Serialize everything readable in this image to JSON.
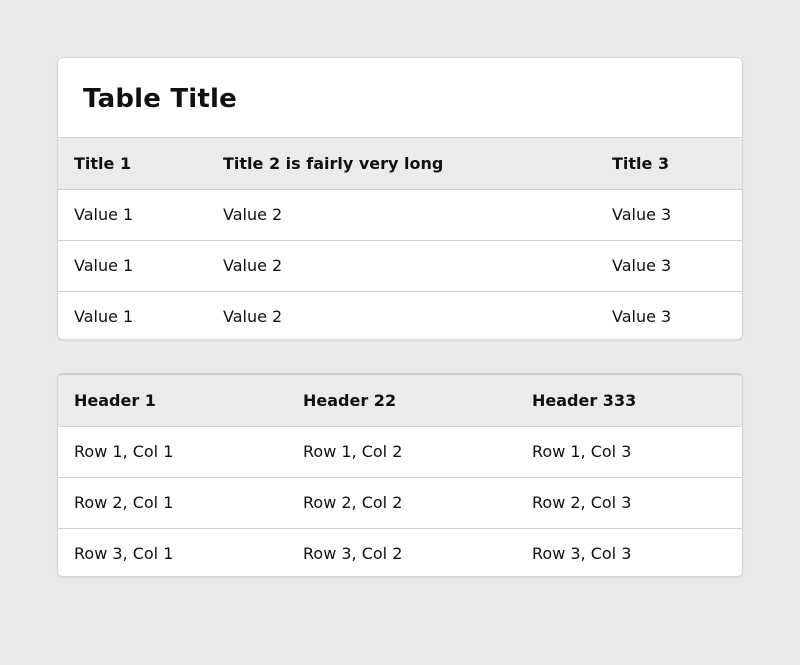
{
  "table1": {
    "title": "Table Title",
    "headers": [
      "Title 1",
      "Title 2 is fairly very long",
      "Title 3"
    ],
    "rows": [
      [
        "Value 1",
        "Value 2",
        "Value 3"
      ],
      [
        "Value 1",
        "Value 2",
        "Value 3"
      ],
      [
        "Value 1",
        "Value 2",
        "Value 3"
      ]
    ]
  },
  "table2": {
    "headers": [
      "Header 1",
      "Header 22",
      "Header 333"
    ],
    "rows": [
      [
        "Row 1, Col 1",
        "Row 1, Col 2",
        "Row 1, Col 3"
      ],
      [
        "Row 2, Col 1",
        "Row 2, Col 2",
        "Row 2, Col 3"
      ],
      [
        "Row 3, Col 1",
        "Row 3, Col 2",
        "Row 3, Col 3"
      ]
    ]
  }
}
